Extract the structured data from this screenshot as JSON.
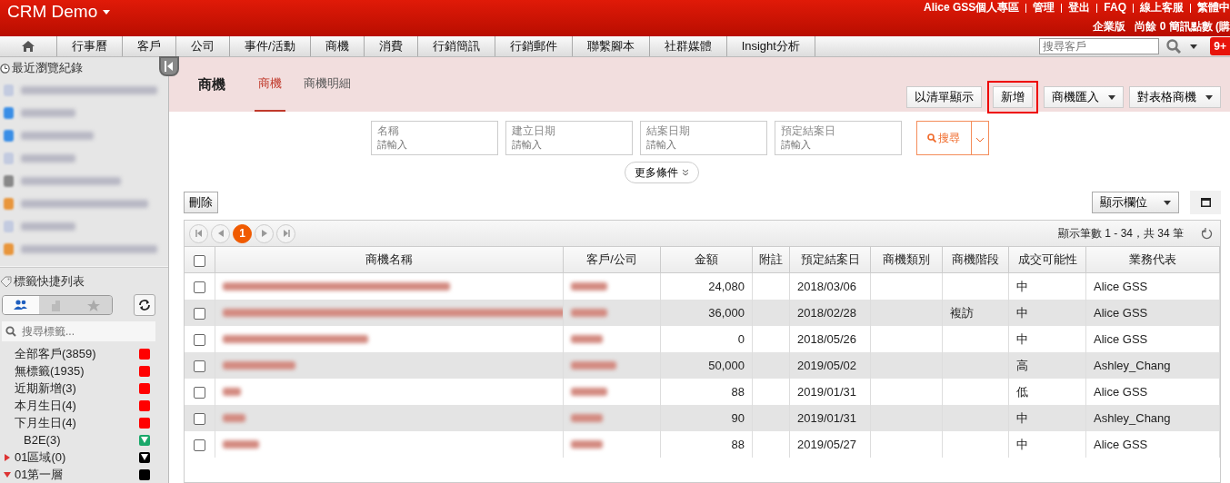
{
  "app": {
    "title": "CRM Demo"
  },
  "top_links": [
    "Alice GSS個人專區",
    "管理",
    "登出",
    "FAQ",
    "線上客服",
    "繁體中"
  ],
  "account_line": [
    "企業版",
    "尚餘 0 簡訊點數 (購"
  ],
  "nav": {
    "items": [
      "行事曆",
      "客戶",
      "公司",
      "事件/活動",
      "商機",
      "消費",
      "行銷簡訊",
      "行銷郵件",
      "聯繫腳本",
      "社群媒體",
      "Insight分析"
    ],
    "search": {
      "placeholder": "搜尋客戶"
    },
    "badge": "9+"
  },
  "recent": {
    "title": "最近瀏覽紀錄",
    "items": [
      {
        "color": "#c3cbe0"
      },
      {
        "color": "#3a8ee6"
      },
      {
        "color": "#3a8ee6"
      },
      {
        "color": "#c3cbe0"
      },
      {
        "color": "#888888"
      },
      {
        "color": "#e8963c"
      },
      {
        "color": "#c3cbe0"
      },
      {
        "color": "#e8963c"
      }
    ]
  },
  "tags": {
    "title": "標籤快捷列表",
    "tabs": [
      {
        "kind": "people",
        "selected": true
      },
      {
        "kind": "building",
        "selected": false
      },
      {
        "kind": "star",
        "selected": false
      }
    ],
    "search": {
      "placeholder": "搜尋標籤..."
    },
    "items": [
      {
        "label": "全部客戶(3859)",
        "kind": "square",
        "color": "#ff0000"
      },
      {
        "label": "無標籤(1935)",
        "kind": "square",
        "color": "#ff0000"
      },
      {
        "label": "近期新增(3)",
        "kind": "square",
        "color": "#ff0000"
      },
      {
        "label": "本月生日(4)",
        "kind": "square",
        "color": "#ff0000"
      },
      {
        "label": "下月生日(4)",
        "kind": "square",
        "color": "#ff0000",
        "children": [
          {
            "label": "B2E(3)",
            "kind": "triangle",
            "color": "#1aa86a"
          }
        ]
      },
      {
        "label": "01區域(0)",
        "kind": "triangle",
        "color": "#000000",
        "expanded": false
      },
      {
        "label": "01第一層",
        "kind": "square",
        "color": "#000000",
        "expanded": true
      }
    ]
  },
  "page": {
    "title": "商機",
    "tabs": [
      {
        "label": "商機",
        "selected": true
      },
      {
        "label": "商機明細",
        "selected": false
      }
    ],
    "actions": [
      {
        "label": "以清單顯示",
        "dropdown": false,
        "highlighted": false
      },
      {
        "label": "新增",
        "dropdown": false,
        "highlighted": true
      },
      {
        "label": "商機匯入",
        "dropdown": true,
        "highlighted": false
      },
      {
        "label": "對表格商機",
        "dropdown": true,
        "highlighted": false
      }
    ]
  },
  "filters": [
    {
      "label": "名稱",
      "placeholder": "請輸入"
    },
    {
      "label": "建立日期",
      "placeholder": "請輸入"
    },
    {
      "label": "結案日期",
      "placeholder": "請輸入"
    },
    {
      "label": "預定結案日",
      "placeholder": "請輸入"
    }
  ],
  "search_button": "搜尋",
  "more_button": "更多條件",
  "delete_button": "刪除",
  "columns_button": "顯示欄位",
  "pager": {
    "current": "1",
    "summary": "顯示筆數 1 - 34，共 34 筆"
  },
  "table": {
    "all_checked": false,
    "columns": [
      "商機名稱",
      "客戶/公司",
      "金額",
      "附註",
      "預定結案日",
      "商機類別",
      "商機階段",
      "成交可能性",
      "業務代表"
    ],
    "rows": [
      {
        "checked": false,
        "amount": "24,080",
        "note": "",
        "date": "2018/03/06",
        "type": "",
        "stage": "",
        "probability": "中",
        "rep": "Alice GSS"
      },
      {
        "checked": false,
        "amount": "36,000",
        "note": "",
        "date": "2018/02/28",
        "type": "",
        "stage": "複訪",
        "probability": "中",
        "rep": "Alice GSS"
      },
      {
        "checked": false,
        "amount": "0",
        "note": "",
        "date": "2018/05/26",
        "type": "",
        "stage": "",
        "probability": "中",
        "rep": "Alice GSS"
      },
      {
        "checked": false,
        "amount": "50,000",
        "note": "",
        "date": "2019/05/02",
        "type": "",
        "stage": "",
        "probability": "高",
        "rep": "Ashley_Chang"
      },
      {
        "checked": false,
        "amount": "88",
        "note": "",
        "date": "2019/01/31",
        "type": "",
        "stage": "",
        "probability": "低",
        "rep": "Alice GSS"
      },
      {
        "checked": false,
        "amount": "90",
        "note": "",
        "date": "2019/01/31",
        "type": "",
        "stage": "",
        "probability": "中",
        "rep": "Ashley_Chang"
      },
      {
        "checked": false,
        "amount": "88",
        "note": "",
        "date": "2019/05/27",
        "type": "",
        "stage": "",
        "probability": "中",
        "rep": "Alice GSS"
      }
    ]
  }
}
